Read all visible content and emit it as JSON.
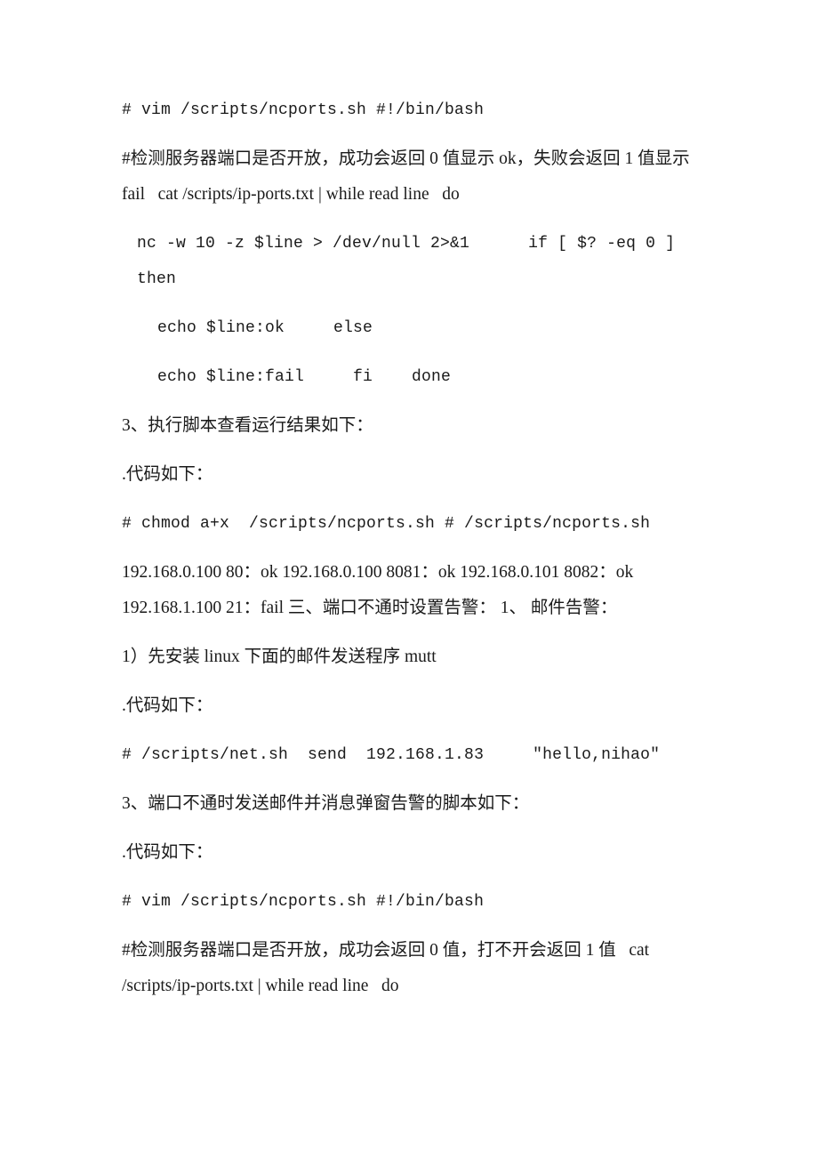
{
  "document": {
    "page_background": "#ffffff",
    "text_color": "#1a1a1a",
    "paragraphs": [
      {
        "id": "p1",
        "kind": "code",
        "indent": 0,
        "text": "# vim /scripts/ncports.sh #!/bin/bash"
      },
      {
        "id": "p2",
        "kind": "mixed",
        "indent": 0,
        "text": "#检测服务器端口是否开放，成功会返回 0 值显示 ok，失败会返回 1 值显示 fail   cat /scripts/ip-ports.txt | while read line   do"
      },
      {
        "id": "p3",
        "kind": "code",
        "indent": 1,
        "text": "nc -w 10 -z $line > /dev/null 2>&1      if [ $? -eq 0 ] then"
      },
      {
        "id": "p4",
        "kind": "code",
        "indent": 2,
        "text": "echo $line:ok     else"
      },
      {
        "id": "p5",
        "kind": "code",
        "indent": 2,
        "text": "echo $line:fail     fi    done"
      },
      {
        "id": "p6",
        "kind": "cjk",
        "indent": 0,
        "text": "3、执行脚本查看运行结果如下："
      },
      {
        "id": "p7",
        "kind": "cjk",
        "indent": 0,
        "text": ".代码如下："
      },
      {
        "id": "p8",
        "kind": "code",
        "indent": 0,
        "text": "# chmod a+x  /scripts/ncports.sh # /scripts/ncports.sh"
      },
      {
        "id": "p9",
        "kind": "mixed",
        "indent": 0,
        "text": "192.168.0.100 80：ok 192.168.0.100 8081：ok 192.168.0.101 8082：ok 192.168.1.100 21：fail 三、端口不通时设置告警： 1、 邮件告警："
      },
      {
        "id": "p10",
        "kind": "mixed",
        "indent": 0,
        "text": "1）先安装 linux 下面的邮件发送程序 mutt"
      },
      {
        "id": "p11",
        "kind": "cjk",
        "indent": 0,
        "text": ".代码如下："
      },
      {
        "id": "p12",
        "kind": "code",
        "indent": 0,
        "text": "# /scripts/net.sh  send  192.168.1.83     \"hello,nihao\""
      },
      {
        "id": "p13",
        "kind": "cjk",
        "indent": 0,
        "text": "3、端口不通时发送邮件并消息弹窗告警的脚本如下："
      },
      {
        "id": "p14",
        "kind": "cjk",
        "indent": 0,
        "text": ".代码如下："
      },
      {
        "id": "p15",
        "kind": "code",
        "indent": 0,
        "text": "# vim /scripts/ncports.sh #!/bin/bash"
      },
      {
        "id": "p16",
        "kind": "mixed",
        "indent": 0,
        "text": "#检测服务器端口是否开放，成功会返回 0 值，打不开会返回 1 值   cat /scripts/ip-ports.txt | while read line   do"
      }
    ]
  }
}
